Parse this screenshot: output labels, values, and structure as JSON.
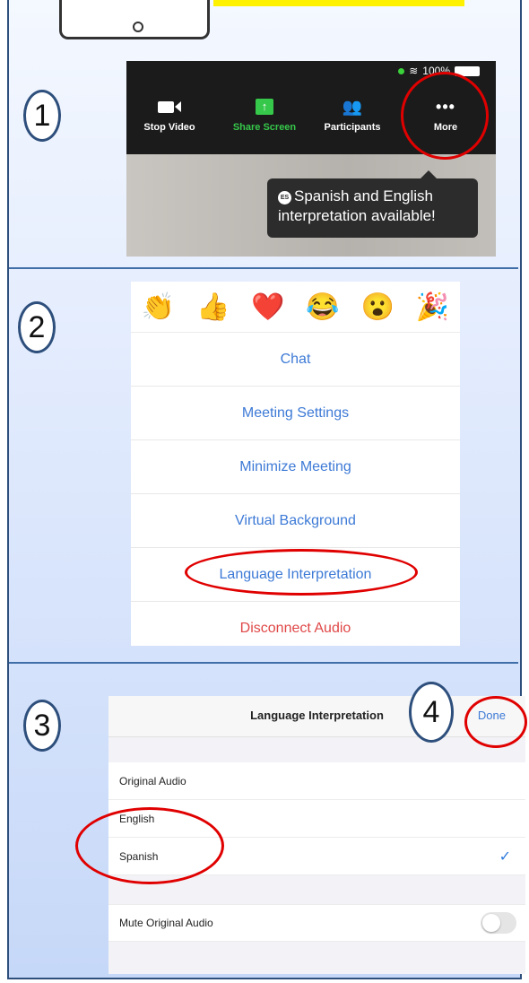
{
  "steps": [
    "1",
    "2",
    "3",
    "4"
  ],
  "zoom": {
    "status_text": "100%",
    "toolbar": [
      {
        "label": "Stop Video",
        "icon": "video-camera-icon"
      },
      {
        "label": "Share Screen",
        "icon": "share-screen-icon"
      },
      {
        "label": "Participants",
        "icon": "participants-icon"
      },
      {
        "label": "More",
        "icon": "more-dots-icon"
      }
    ],
    "tooltip_badge": "ES",
    "tooltip_line1": "Spanish and English",
    "tooltip_line2": "interpretation available!"
  },
  "menu": {
    "reactions": [
      "👏",
      "👍",
      "❤️",
      "😂",
      "😮",
      "🎉"
    ],
    "items": [
      "Chat",
      "Meeting Settings",
      "Minimize Meeting",
      "Virtual Background",
      "Language Interpretation",
      "Disconnect Audio"
    ]
  },
  "language_panel": {
    "title": "Language Interpretation",
    "done": "Done",
    "options": [
      "Original Audio",
      "English",
      "Spanish"
    ],
    "selected": "Spanish",
    "check": "✓",
    "mute_label": "Mute Original Audio",
    "mute_on": false
  },
  "colors": {
    "highlight_ring": "#e00000",
    "badge_border": "#2e4f7c",
    "accent_blue": "#3d7ad6",
    "share_green": "#36c84a"
  }
}
